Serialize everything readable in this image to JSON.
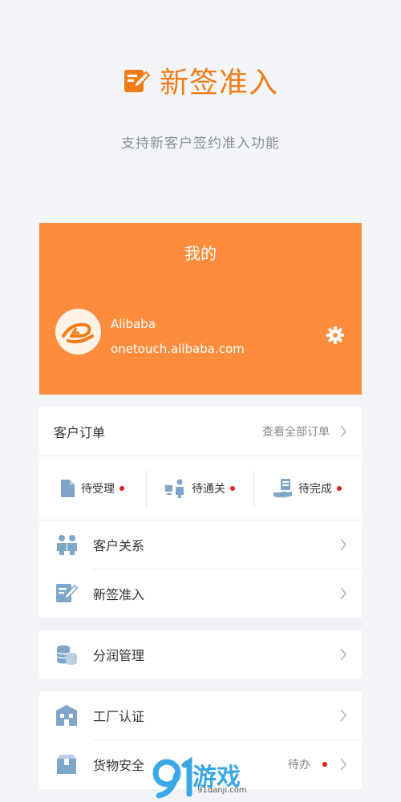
{
  "promo": {
    "title": "新签准入",
    "subtitle": "支持新客户签约准入功能"
  },
  "header": {
    "title": "我的",
    "username": "Alibaba",
    "email": "onetouch.alibaba.com"
  },
  "orders": {
    "label": "客户订单",
    "view_all": "查看全部订单",
    "statuses": [
      {
        "label": "待受理"
      },
      {
        "label": "待通关"
      },
      {
        "label": "待完成"
      }
    ]
  },
  "menu": {
    "customer_relation": "客户关系",
    "new_sign": "新签准入",
    "profit_manage": "分润管理",
    "factory_cert": "工厂认证",
    "goods_safety": "货物安全",
    "goods_safety_badge": "待办"
  },
  "watermark": {
    "brand": "游戏",
    "url": "91danji.com"
  },
  "colors": {
    "accent": "#f07d19",
    "header_bg": "#fd8d3d",
    "icon_blue": "#7fa6c9",
    "badge_dot": "#e01e1e"
  }
}
